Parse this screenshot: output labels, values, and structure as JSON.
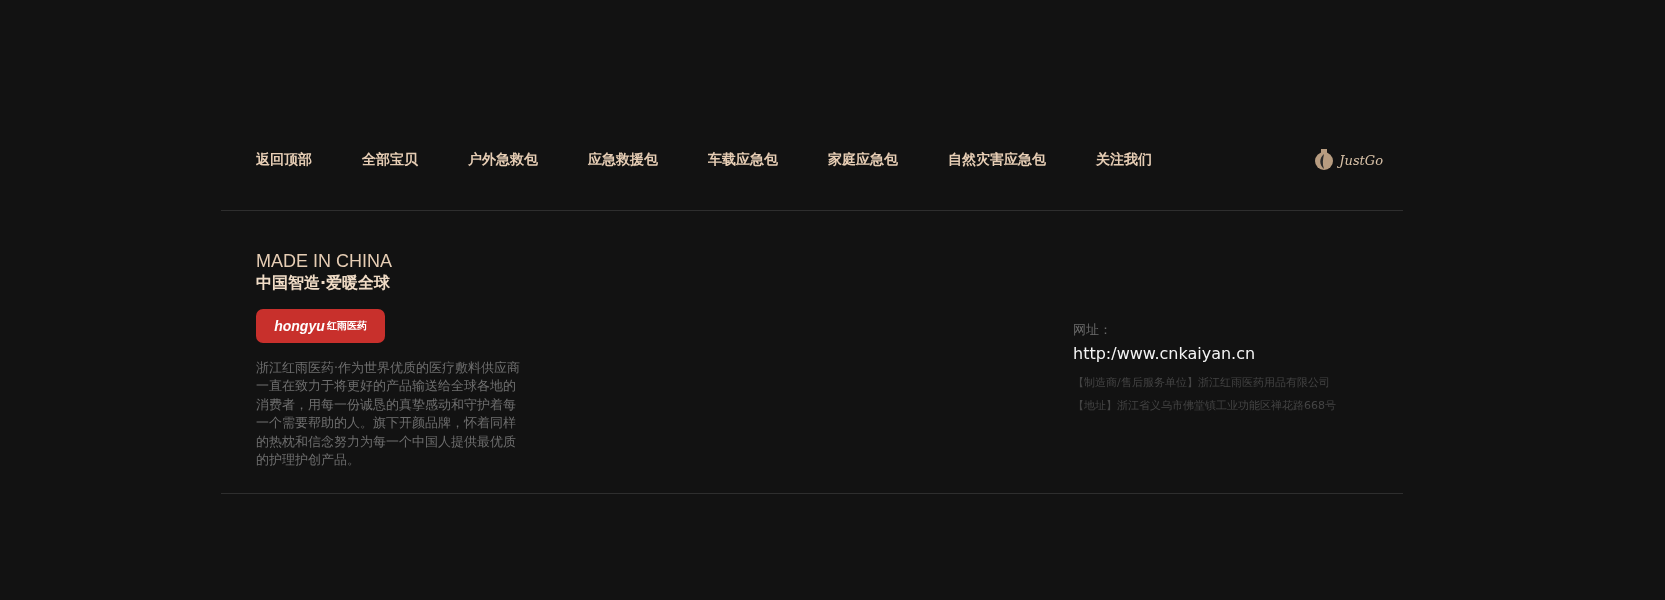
{
  "nav": {
    "items": [
      {
        "label": "返回顶部"
      },
      {
        "label": "全部宝贝"
      },
      {
        "label": "户外急救包"
      },
      {
        "label": "应急救援包"
      },
      {
        "label": "车载应急包"
      },
      {
        "label": "家庭应急包"
      },
      {
        "label": "自然灾害应急包"
      },
      {
        "label": "关注我们"
      }
    ],
    "logo": {
      "text": "JustGo"
    }
  },
  "about": {
    "tagline": "MADE IN CHINA",
    "slogan": "中国智造·爱暖全球",
    "brand_badge": {
      "latin": "hongyu",
      "chinese": "红雨医药"
    },
    "description": "浙江红雨医药·作为世界优质的医疗敷料供应商一直在致力于将更好的产品输送给全球各地的消费者，用每一份诚恳的真挚感动和守护着每一个需要帮助的人。旗下开颜品牌，怀着同样的热枕和信念努力为每一个中国人提供最优质的护理护创产品。"
  },
  "contact": {
    "website_label": "网址：",
    "website": "http:/www.cnkaiyan.cn",
    "lines": [
      "【制造商/售后服务单位】浙江红雨医药用品有限公司",
      "【地址】浙江省义乌市佛堂镇工业功能区禅花路668号"
    ]
  }
}
